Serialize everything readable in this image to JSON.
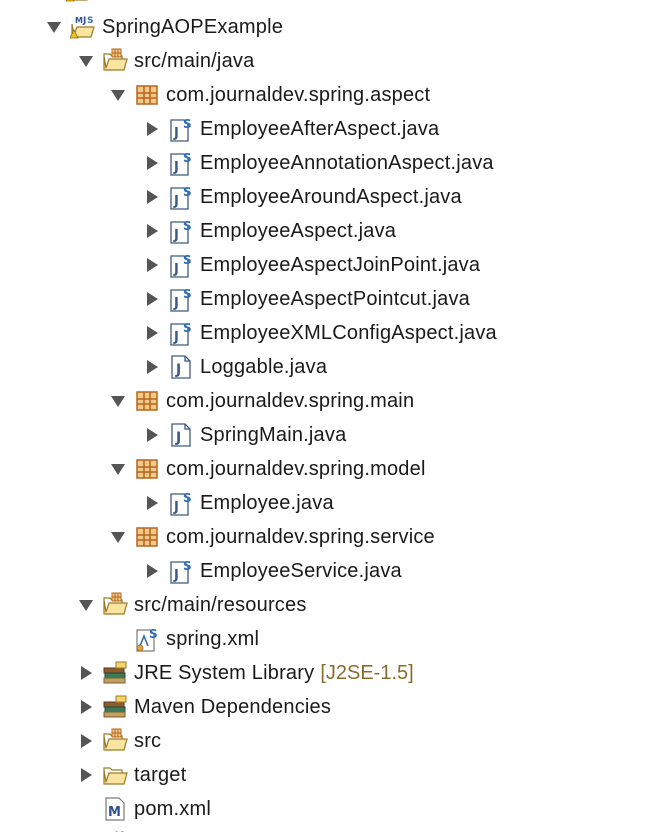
{
  "tree": {
    "project": "SpringAOPExample",
    "src_main_java": "src/main/java",
    "pkg_aspect": "com.journaldev.spring.aspect",
    "aspect_files": [
      "EmployeeAfterAspect.java",
      "EmployeeAnnotationAspect.java",
      "EmployeeAroundAspect.java",
      "EmployeeAspect.java",
      "EmployeeAspectJoinPoint.java",
      "EmployeeAspectPointcut.java",
      "EmployeeXMLConfigAspect.java",
      "Loggable.java"
    ],
    "pkg_main": "com.journaldev.spring.main",
    "main_file": "SpringMain.java",
    "pkg_model": "com.journaldev.spring.model",
    "model_file": "Employee.java",
    "pkg_service": "com.journaldev.spring.service",
    "service_file": "EmployeeService.java",
    "src_main_resources": "src/main/resources",
    "spring_xml": "spring.xml",
    "jre_library": "JRE System Library",
    "jre_version": "[J2SE-1.5]",
    "maven_dependencies": "Maven Dependencies",
    "src": "src",
    "target": "target",
    "pom": "pom.xml"
  },
  "icons": {
    "project": "maven-java-project-icon",
    "source_folder": "source-folder-icon",
    "package": "package-icon",
    "java_spring": "java-spring-file-icon",
    "java": "java-file-icon",
    "xml_spring": "spring-xml-file-icon",
    "library": "library-icon",
    "folder": "folder-icon",
    "pom": "maven-pom-icon"
  },
  "colors": {
    "label": "#1a1a1a",
    "decoration": "#8a6d2c",
    "twisty": "#555555"
  }
}
